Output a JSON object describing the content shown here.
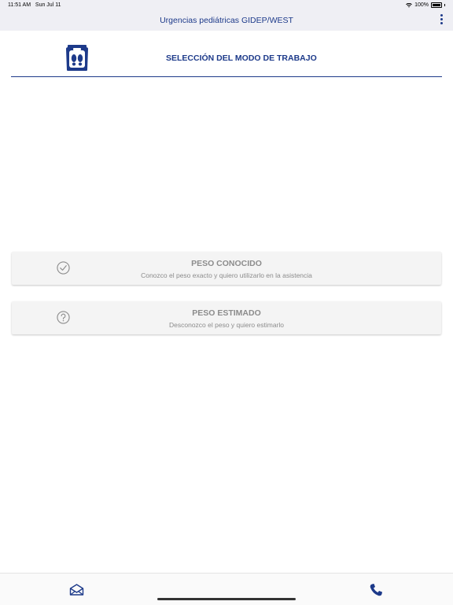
{
  "status_bar": {
    "time": "11:51 AM",
    "date": "Sun Jul 11",
    "battery": "100%",
    "wifi_icon": "wifi-icon",
    "battery_icon": "battery-icon"
  },
  "nav": {
    "title": "Urgencias pediátricas GIDEP/WEST",
    "menu_icon": "more-vertical-icon"
  },
  "header": {
    "logo_icon": "scale-footprints-icon",
    "title": "SELECCIÓN DEL MODO DE TRABAJO"
  },
  "modes": [
    {
      "icon": "check-circle-icon",
      "title": "PESO CONOCIDO",
      "description": "Conozco el peso exacto y quiero utilizarlo en la asistencia"
    },
    {
      "icon": "question-circle-icon",
      "title": "PESO ESTIMADO",
      "description": "Desconozco el peso y quiero estimarlo"
    }
  ],
  "tabs": [
    {
      "icon": "mail-icon"
    },
    {
      "icon": "phone-icon"
    }
  ],
  "colors": {
    "accent": "#1d3a8a",
    "card_background": "#f4f4f4",
    "card_text": "#8c8c8c",
    "bar_background": "#efeff4"
  }
}
